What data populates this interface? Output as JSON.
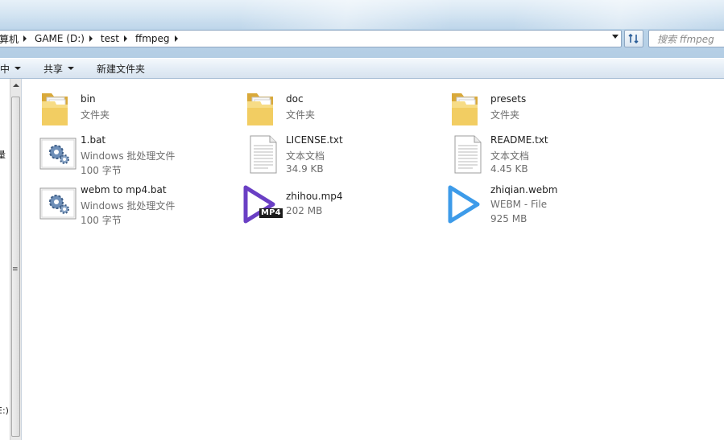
{
  "breadcrumb": [
    {
      "label": "算机"
    },
    {
      "label": "GAME (D:)"
    },
    {
      "label": "test"
    },
    {
      "label": "ffmpeg"
    }
  ],
  "search": {
    "placeholder": "搜索 ffmpeg"
  },
  "toolbar": {
    "include_label": "库中",
    "share_label": "共享",
    "new_folder_label": "新建文件夹"
  },
  "navpane": {
    "item_1": "量",
    "item_2": "E:)"
  },
  "files": [
    {
      "name": "bin",
      "line1": "文件夹",
      "line2": "",
      "icon": "folder-icon"
    },
    {
      "name": "doc",
      "line1": "文件夹",
      "line2": "",
      "icon": "folder-icon"
    },
    {
      "name": "presets",
      "line1": "文件夹",
      "line2": "",
      "icon": "folder-icon"
    },
    {
      "name": "1.bat",
      "line1": "Windows 批处理文件",
      "line2": "100 字节",
      "icon": "batch-file-icon"
    },
    {
      "name": "LICENSE.txt",
      "line1": "文本文档",
      "line2": "34.9 KB",
      "icon": "text-file-icon"
    },
    {
      "name": "README.txt",
      "line1": "文本文档",
      "line2": "4.45 KB",
      "icon": "text-file-icon"
    },
    {
      "name": "webm to mp4.bat",
      "line1": "Windows 批处理文件",
      "line2": "100 字节",
      "icon": "batch-file-icon"
    },
    {
      "name": "zhihou.mp4",
      "line1": "202 MB",
      "line2": "",
      "icon": "mp4-video-icon",
      "badge": "MP4"
    },
    {
      "name": "zhiqian.webm",
      "line1": "WEBM - File",
      "line2": "925 MB",
      "icon": "webm-video-icon"
    }
  ],
  "colors": {
    "mp4_play": "#6a3fc4",
    "webm_play": "#3d9be9",
    "folder": "#f2cd62"
  }
}
